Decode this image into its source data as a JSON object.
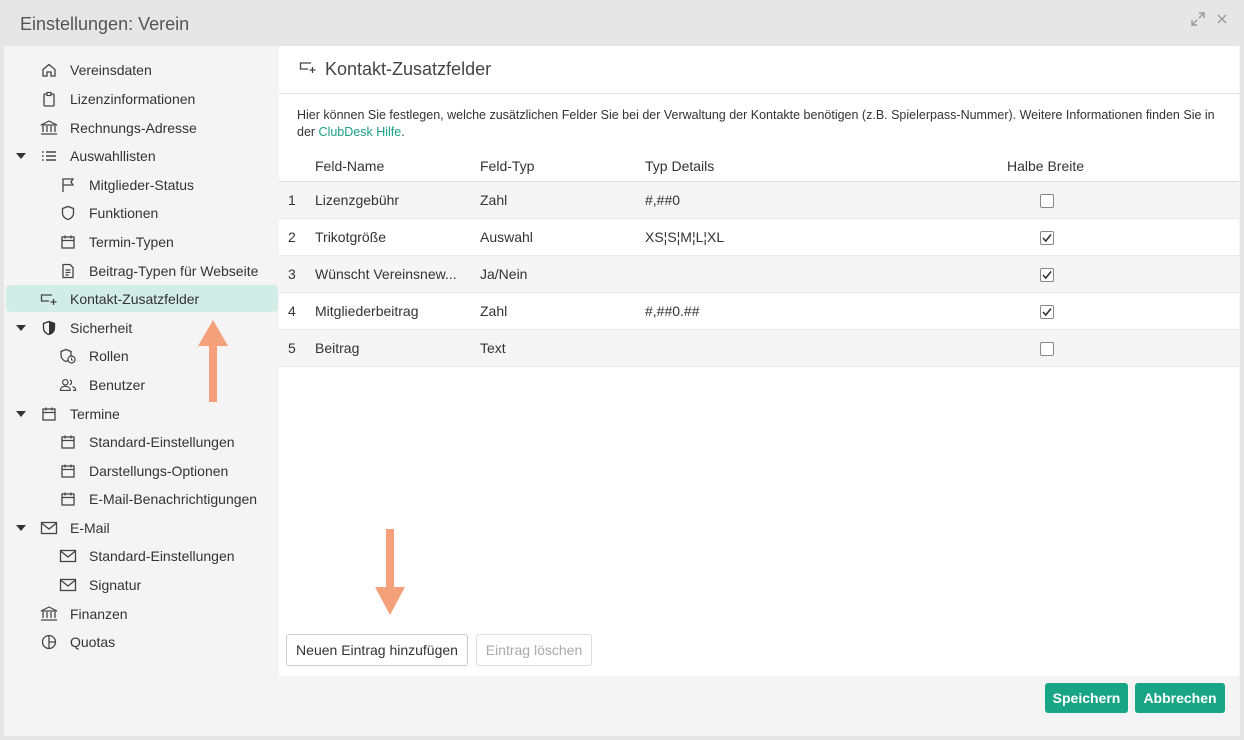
{
  "window": {
    "title": "Einstellungen: Verein"
  },
  "sidebar": {
    "items": [
      {
        "label": "Vereinsdaten",
        "icon": "home-icon"
      },
      {
        "label": "Lizenzinformationen",
        "icon": "clipboard-icon"
      },
      {
        "label": "Rechnungs-Adresse",
        "icon": "bank-icon"
      },
      {
        "label": "Auswahllisten",
        "icon": "list-icon"
      },
      {
        "label": "Mitglieder-Status",
        "icon": "flag-icon"
      },
      {
        "label": "Funktionen",
        "icon": "shield-outline-icon"
      },
      {
        "label": "Termin-Typen",
        "icon": "calendar-icon"
      },
      {
        "label": "Beitrag-Typen für Webseite",
        "icon": "document-icon"
      },
      {
        "label": "Kontakt-Zusatzfelder",
        "icon": "field-add-icon"
      },
      {
        "label": "Sicherheit",
        "icon": "security-shield-icon"
      },
      {
        "label": "Rollen",
        "icon": "role-shield-icon"
      },
      {
        "label": "Benutzer",
        "icon": "users-icon"
      },
      {
        "label": "Termine",
        "icon": "calendar-icon"
      },
      {
        "label": "Standard-Einstellungen",
        "icon": "calendar-icon"
      },
      {
        "label": "Darstellungs-Optionen",
        "icon": "calendar-icon"
      },
      {
        "label": "E-Mail-Benachrichtigungen",
        "icon": "calendar-icon"
      },
      {
        "label": "E-Mail",
        "icon": "mail-icon"
      },
      {
        "label": "Standard-Einstellungen",
        "icon": "mail-icon"
      },
      {
        "label": "Signatur",
        "icon": "mail-icon"
      },
      {
        "label": "Finanzen",
        "icon": "bank-icon"
      },
      {
        "label": "Quotas",
        "icon": "pie-chart-icon"
      }
    ]
  },
  "content": {
    "title": "Kontakt-Zusatzfelder",
    "description": "Hier können Sie festlegen, welche zusätzlichen Felder Sie bei der Verwaltung der Kontakte benötigen (z.B. Spielerpass-Nummer). Weitere Informationen finden Sie in der ",
    "link_label": "ClubDesk Hilfe",
    "description_end": ".",
    "table": {
      "columns": [
        "Feld-Name",
        "Feld-Typ",
        "Typ Details",
        "Halbe Breite"
      ],
      "rows": [
        {
          "num": "1",
          "name": "Lizenzgebühr",
          "type": "Zahl",
          "details": "#,##0",
          "half_width": false
        },
        {
          "num": "2",
          "name": "Trikotgröße",
          "type": "Auswahl",
          "details": "XS¦S¦M¦L¦XL",
          "half_width": true
        },
        {
          "num": "3",
          "name": "Wünscht Vereinsnew...",
          "type": "Ja/Nein",
          "details": "",
          "half_width": true
        },
        {
          "num": "4",
          "name": "Mitgliederbeitrag",
          "type": "Zahl",
          "details": "#,##0.##",
          "half_width": true
        },
        {
          "num": "5",
          "name": "Beitrag",
          "type": "Text",
          "details": "",
          "half_width": false
        }
      ]
    },
    "add_button": "Neuen Eintrag hinzufügen",
    "delete_button": "Eintrag löschen"
  },
  "footer": {
    "save_button": "Speichern",
    "cancel_button": "Abbrechen"
  },
  "colors": {
    "accent": "#18a586",
    "active_bg": "#d2ece6",
    "annotation_arrow": "#f4a07a"
  }
}
